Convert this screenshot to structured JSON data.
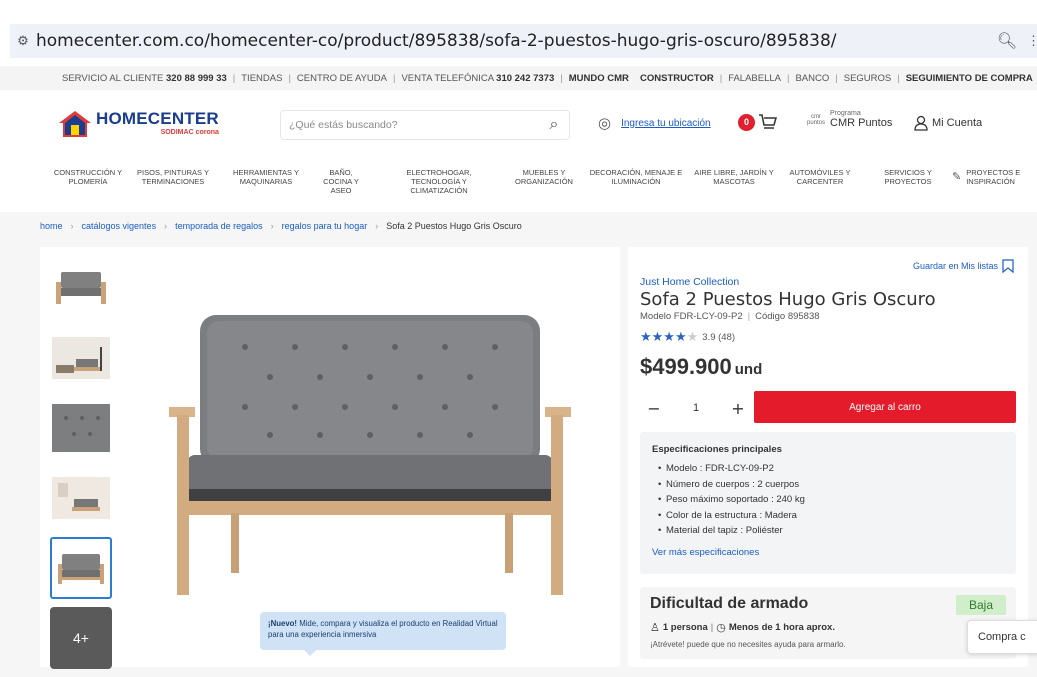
{
  "browser": {
    "url": "homecenter.com.co/homecenter-co/product/895838/sofa-2-puestos-hugo-gris-oscuro/895838/"
  },
  "topbar": {
    "left": [
      "SERVICIO AL CLIENTE",
      "320 88 999 33",
      "TIENDAS",
      "CENTRO DE AYUDA",
      "VENTA TELEFÓNICA",
      "310 242 7373",
      "MUNDO CMR"
    ],
    "right": [
      "CONSTRUCTOR",
      "FALABELLA",
      "BANCO",
      "SEGUROS",
      "SEGUIMIENTO DE COMPRA"
    ]
  },
  "header": {
    "logo_name": "HOMECENTER",
    "logo_sub": "SODIMAC corona",
    "search_placeholder": "¿Qué estás buscando?",
    "location_link": "Ingresa tu ubicación",
    "cart_count": "0",
    "puntos_label": "CMR Puntos",
    "program_label": "Programa",
    "program_name": "CMR Puntos",
    "account_label": "Mi Cuenta"
  },
  "categories": [
    "CONSTRUCCIÓN Y PLOMERÍA",
    "PISOS, PINTURAS Y TERMINACIONES",
    "HERRAMIENTAS Y MAQUINARIAS",
    "BAÑO, COCINA Y ASEO",
    "ELECTROHOGAR, TECNOLOGÍA Y CLIMATIZACIÓN",
    "MUEBLES Y ORGANIZACIÓN",
    "DECORACIÓN, MENAJE E ILUMINACIÓN",
    "AIRE LIBRE, JARDÍN Y MASCOTAS",
    "AUTOMÓVILES Y CARCENTER",
    "SERVICIOS Y PROYECTOS",
    "PROYECTOS E INSPIRACIÓN"
  ],
  "breadcrumb": [
    "home",
    "catálogos vigentes",
    "temporada de regalos",
    "regalos para tu hogar",
    "Sofa 2 Puestos Hugo Gris Oscuro"
  ],
  "gallery": {
    "more_label": "4+",
    "ar_banner_strong": "¡Nuevo!",
    "ar_banner_text": "Mide, compara y visualiza el producto en Realidad Virtual para una experiencia inmersiva"
  },
  "product": {
    "save_list": "Guardar en Mis listas",
    "brand": "Just Home Collection",
    "title": "Sofa 2 Puestos Hugo Gris Oscuro",
    "model": "Modelo FDR-LCY-09-P2",
    "code": "Código 895838",
    "rating": 3.9,
    "rating_text": "3.9",
    "reviews": "(48)",
    "price": "$499.900",
    "price_unit": "und",
    "quantity": "1",
    "add_to_cart": "Agregar al carro"
  },
  "specs": {
    "heading": "Especificaciones principales",
    "items": [
      "Modelo : FDR-LCY-09-P2",
      "Número de cuerpos : 2 cuerpos",
      "Peso máximo soportado : 240 kg",
      "Color de la estructura : Madera",
      "Material del tapiz : Poliéster"
    ],
    "more_link": "Ver más especificaciones"
  },
  "assembly": {
    "heading": "Dificultad de armado",
    "level": "Baja",
    "people": "1 persona",
    "time": "Menos de 1 hora aprox.",
    "note": "¡Atrévete! puede que no necesites ayuda para armarlo."
  },
  "floating": {
    "compare": "Compra c"
  },
  "colors": {
    "brand_blue": "#1a3d8f",
    "link_blue": "#1a5dc9",
    "cta_red": "#e31b2a",
    "star_blue": "#2b63c4",
    "badge_green_bg": "#cfeec9"
  }
}
